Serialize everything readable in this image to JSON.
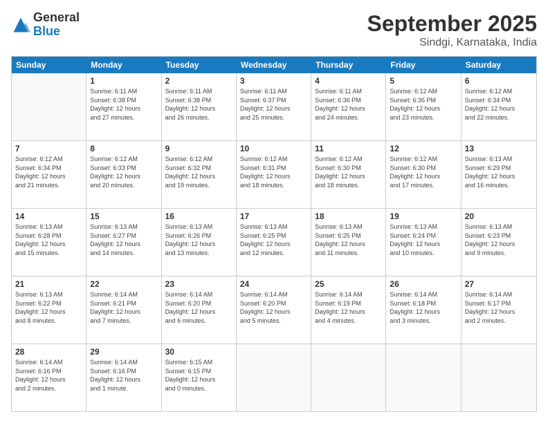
{
  "logo": {
    "general": "General",
    "blue": "Blue"
  },
  "header": {
    "title": "September 2025",
    "subtitle": "Sindgi, Karnataka, India"
  },
  "calendar": {
    "days": [
      "Sunday",
      "Monday",
      "Tuesday",
      "Wednesday",
      "Thursday",
      "Friday",
      "Saturday"
    ],
    "rows": [
      [
        {
          "day": "",
          "info": ""
        },
        {
          "day": "1",
          "info": "Sunrise: 6:11 AM\nSunset: 6:38 PM\nDaylight: 12 hours\nand 27 minutes."
        },
        {
          "day": "2",
          "info": "Sunrise: 6:11 AM\nSunset: 6:38 PM\nDaylight: 12 hours\nand 26 minutes."
        },
        {
          "day": "3",
          "info": "Sunrise: 6:11 AM\nSunset: 6:37 PM\nDaylight: 12 hours\nand 25 minutes."
        },
        {
          "day": "4",
          "info": "Sunrise: 6:11 AM\nSunset: 6:36 PM\nDaylight: 12 hours\nand 24 minutes."
        },
        {
          "day": "5",
          "info": "Sunrise: 6:12 AM\nSunset: 6:35 PM\nDaylight: 12 hours\nand 23 minutes."
        },
        {
          "day": "6",
          "info": "Sunrise: 6:12 AM\nSunset: 6:34 PM\nDaylight: 12 hours\nand 22 minutes."
        }
      ],
      [
        {
          "day": "7",
          "info": "Sunrise: 6:12 AM\nSunset: 6:34 PM\nDaylight: 12 hours\nand 21 minutes."
        },
        {
          "day": "8",
          "info": "Sunrise: 6:12 AM\nSunset: 6:33 PM\nDaylight: 12 hours\nand 20 minutes."
        },
        {
          "day": "9",
          "info": "Sunrise: 6:12 AM\nSunset: 6:32 PM\nDaylight: 12 hours\nand 19 minutes."
        },
        {
          "day": "10",
          "info": "Sunrise: 6:12 AM\nSunset: 6:31 PM\nDaylight: 12 hours\nand 18 minutes."
        },
        {
          "day": "11",
          "info": "Sunrise: 6:12 AM\nSunset: 6:30 PM\nDaylight: 12 hours\nand 18 minutes."
        },
        {
          "day": "12",
          "info": "Sunrise: 6:12 AM\nSunset: 6:30 PM\nDaylight: 12 hours\nand 17 minutes."
        },
        {
          "day": "13",
          "info": "Sunrise: 6:13 AM\nSunset: 6:29 PM\nDaylight: 12 hours\nand 16 minutes."
        }
      ],
      [
        {
          "day": "14",
          "info": "Sunrise: 6:13 AM\nSunset: 6:28 PM\nDaylight: 12 hours\nand 15 minutes."
        },
        {
          "day": "15",
          "info": "Sunrise: 6:13 AM\nSunset: 6:27 PM\nDaylight: 12 hours\nand 14 minutes."
        },
        {
          "day": "16",
          "info": "Sunrise: 6:13 AM\nSunset: 6:26 PM\nDaylight: 12 hours\nand 13 minutes."
        },
        {
          "day": "17",
          "info": "Sunrise: 6:13 AM\nSunset: 6:25 PM\nDaylight: 12 hours\nand 12 minutes."
        },
        {
          "day": "18",
          "info": "Sunrise: 6:13 AM\nSunset: 6:25 PM\nDaylight: 12 hours\nand 11 minutes."
        },
        {
          "day": "19",
          "info": "Sunrise: 6:13 AM\nSunset: 6:24 PM\nDaylight: 12 hours\nand 10 minutes."
        },
        {
          "day": "20",
          "info": "Sunrise: 6:13 AM\nSunset: 6:23 PM\nDaylight: 12 hours\nand 9 minutes."
        }
      ],
      [
        {
          "day": "21",
          "info": "Sunrise: 6:13 AM\nSunset: 6:22 PM\nDaylight: 12 hours\nand 8 minutes."
        },
        {
          "day": "22",
          "info": "Sunrise: 6:14 AM\nSunset: 6:21 PM\nDaylight: 12 hours\nand 7 minutes."
        },
        {
          "day": "23",
          "info": "Sunrise: 6:14 AM\nSunset: 6:20 PM\nDaylight: 12 hours\nand 6 minutes."
        },
        {
          "day": "24",
          "info": "Sunrise: 6:14 AM\nSunset: 6:20 PM\nDaylight: 12 hours\nand 5 minutes."
        },
        {
          "day": "25",
          "info": "Sunrise: 6:14 AM\nSunset: 6:19 PM\nDaylight: 12 hours\nand 4 minutes."
        },
        {
          "day": "26",
          "info": "Sunrise: 6:14 AM\nSunset: 6:18 PM\nDaylight: 12 hours\nand 3 minutes."
        },
        {
          "day": "27",
          "info": "Sunrise: 6:14 AM\nSunset: 6:17 PM\nDaylight: 12 hours\nand 2 minutes."
        }
      ],
      [
        {
          "day": "28",
          "info": "Sunrise: 6:14 AM\nSunset: 6:16 PM\nDaylight: 12 hours\nand 2 minutes."
        },
        {
          "day": "29",
          "info": "Sunrise: 6:14 AM\nSunset: 6:16 PM\nDaylight: 12 hours\nand 1 minute."
        },
        {
          "day": "30",
          "info": "Sunrise: 6:15 AM\nSunset: 6:15 PM\nDaylight: 12 hours\nand 0 minutes."
        },
        {
          "day": "",
          "info": ""
        },
        {
          "day": "",
          "info": ""
        },
        {
          "day": "",
          "info": ""
        },
        {
          "day": "",
          "info": ""
        }
      ]
    ]
  }
}
